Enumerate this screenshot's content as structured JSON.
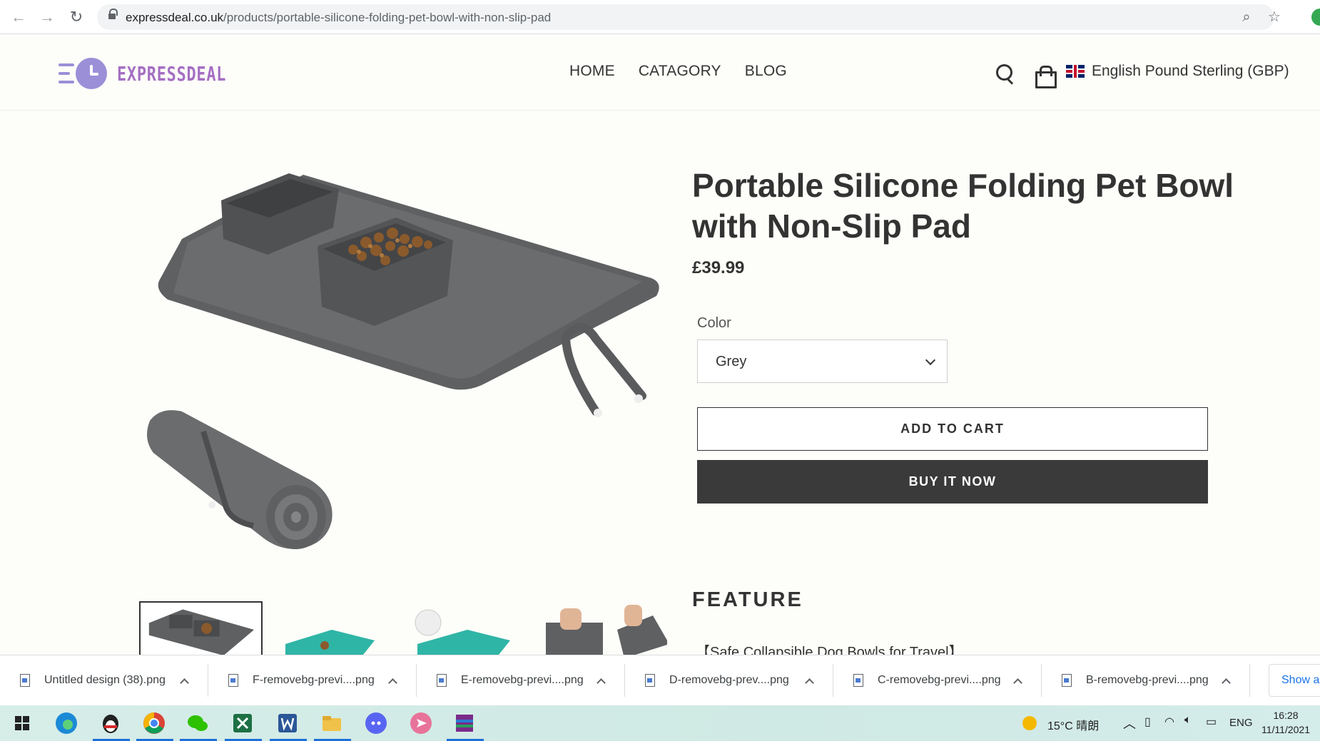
{
  "browser": {
    "url_domain": "expressdeal.co.uk",
    "url_path": "/products/portable-silicone-folding-pet-bowl-with-non-slip-pad"
  },
  "site": {
    "logo_text": "EXPRESSDEAL",
    "nav": [
      "HOME",
      "CATAGORY",
      "BLOG"
    ],
    "currency_label": "English Pound Sterling (GBP)"
  },
  "product": {
    "title": "Portable Silicone Folding Pet Bowl with Non-Slip Pad",
    "price": "£39.99",
    "color_label": "Color",
    "color_value": "Grey",
    "add_to_cart": "ADD TO CART",
    "buy_now": "BUY IT NOW",
    "feature_heading": "FEATURE",
    "feature_first_line": "【Safe Collapsible Dog Bowls for Travel】"
  },
  "downloads": {
    "items": [
      "Untitled design (38).png",
      "F-removebg-previ....png",
      "E-removebg-previ....png",
      "D-removebg-prev....png",
      "C-removebg-previ....png",
      "B-removebg-previ....png"
    ],
    "show_all": "Show all"
  },
  "taskbar": {
    "weather": "15°C 晴朗",
    "language": "ENG",
    "time": "16:28",
    "date": "11/11/2021"
  },
  "colors": {
    "logo_purple": "#a46fc3",
    "logo_icon": "#9b8fd8",
    "buy_now_bg": "#3a3a3a",
    "product_grey": "#5f6062",
    "teal_variant": "#2fb5a6"
  }
}
